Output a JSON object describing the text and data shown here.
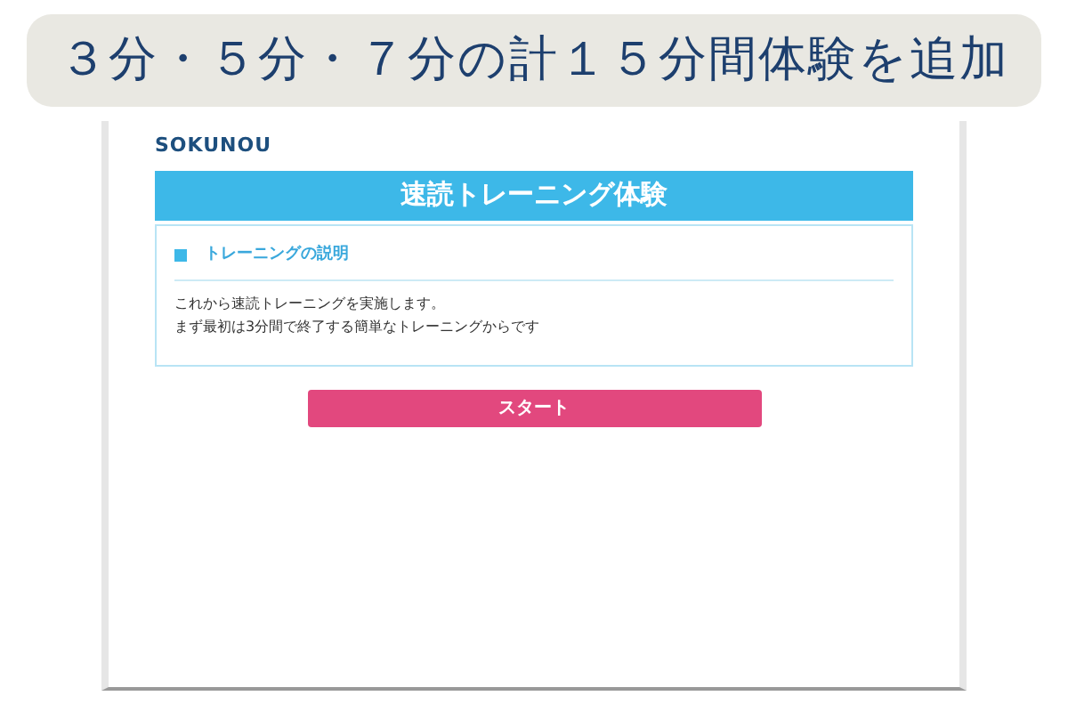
{
  "caption": "３分・５分・７分の計１５分間体験を追加",
  "logo": "SOKUNOU",
  "header": "速読トレーニング体験",
  "section": {
    "title": "トレーニングの説明",
    "lines": [
      "これから速読トレーニングを実施します。",
      "まず最初は3分間で終了する簡単なトレーニングからです"
    ]
  },
  "start_button": "スタート"
}
